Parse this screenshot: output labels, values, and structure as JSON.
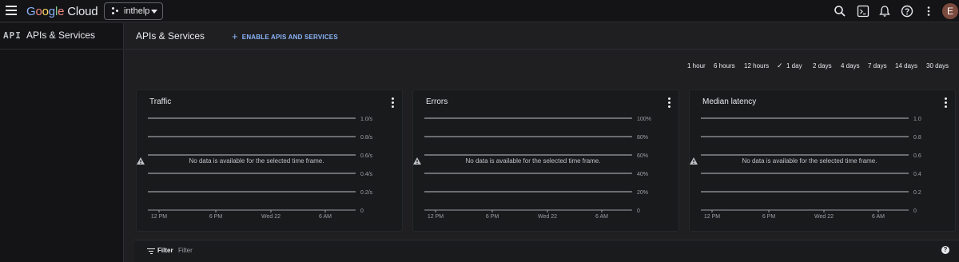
{
  "topbar": {
    "logo": {
      "word1": "Google",
      "word2": "Cloud"
    },
    "project_name": "inthelp",
    "icons": [
      "search-icon",
      "terminal-icon",
      "bell-icon",
      "help-icon",
      "more-vert-icon"
    ],
    "avatar_letter": "E"
  },
  "sidebar": {
    "badge": "API",
    "title": "APIs & Services"
  },
  "header": {
    "title": "APIs & Services",
    "enable_label": "ENABLE APIS AND SERVICES"
  },
  "time_ranges": {
    "options": [
      "1 hour",
      "6 hours",
      "12 hours",
      "1 day",
      "2 days",
      "4 days",
      "7 days",
      "14 days",
      "30 days"
    ],
    "selected": "1 day"
  },
  "cards": [
    {
      "title": "Traffic",
      "ticks": [
        "1.0/s",
        "0.8/s",
        "0.6/s",
        "0.4/s",
        "0.2/s",
        "0"
      ],
      "xticks": [
        "12 PM",
        "6 PM",
        "Wed 22",
        "6 AM"
      ],
      "message": "No data is available for the selected time frame."
    },
    {
      "title": "Errors",
      "ticks": [
        "100%",
        "80%",
        "60%",
        "40%",
        "20%",
        "0"
      ],
      "xticks": [
        "12 PM",
        "6 PM",
        "Wed 22",
        "6 AM"
      ],
      "message": "No data is available for the selected time frame."
    },
    {
      "title": "Median latency",
      "ticks": [
        "1.0",
        "0.8",
        "0.6",
        "0.4",
        "0.2",
        "0"
      ],
      "xticks": [
        "12 PM",
        "6 PM",
        "Wed 22",
        "6 AM"
      ],
      "message": "No data is available for the selected time frame."
    }
  ],
  "filter": {
    "label": "Filter",
    "placeholder": "Filter"
  },
  "colors": {
    "accent": "#8ab4f8",
    "background": "#1f1f21",
    "card": "#191a1c",
    "topbar": "#141416"
  }
}
